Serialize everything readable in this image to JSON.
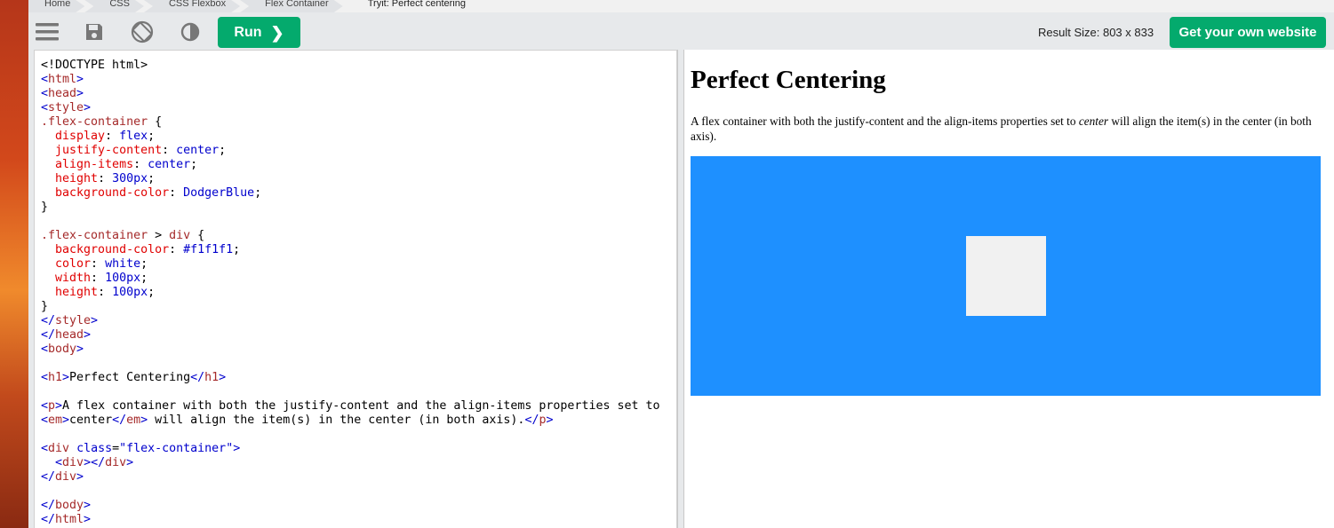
{
  "breadcrumb": [
    "Home",
    "CSS",
    "CSS Flexbox",
    "Flex Container",
    "Tryit: Perfect centering"
  ],
  "toolbar": {
    "menu_icon": "hamburger-menu-icon",
    "save_icon": "save-icon",
    "orientation_icon": "rotate-orientation-icon",
    "theme_icon": "contrast-theme-icon",
    "run_label": "Run",
    "run_chevron": "❯",
    "result_size": "Result Size: 803 x 833",
    "get_website_label": "Get your own website"
  },
  "colors": {
    "accent_green": "#04aa6d",
    "dodger_blue": "#1e90ff",
    "inner_box": "#f1f1f1"
  },
  "editor": {
    "lines": [
      [
        [
          "t-txt",
          "<!DOCTYPE html>"
        ]
      ],
      [
        [
          "t-br",
          "<"
        ],
        [
          "t-tag",
          "html"
        ],
        [
          "t-br",
          ">"
        ]
      ],
      [
        [
          "t-br",
          "<"
        ],
        [
          "t-tag",
          "head"
        ],
        [
          "t-br",
          ">"
        ]
      ],
      [
        [
          "t-br",
          "<"
        ],
        [
          "t-tag",
          "style"
        ],
        [
          "t-br",
          ">"
        ]
      ],
      [
        [
          "t-sel",
          ".flex-container"
        ],
        [
          "t-txt",
          " {"
        ]
      ],
      [
        [
          "t-txt",
          "  "
        ],
        [
          "t-prop",
          "display"
        ],
        [
          "t-txt",
          ": "
        ],
        [
          "t-val",
          "flex"
        ],
        [
          "t-txt",
          ";"
        ]
      ],
      [
        [
          "t-txt",
          "  "
        ],
        [
          "t-prop",
          "justify-content"
        ],
        [
          "t-txt",
          ": "
        ],
        [
          "t-val",
          "center"
        ],
        [
          "t-txt",
          ";"
        ]
      ],
      [
        [
          "t-txt",
          "  "
        ],
        [
          "t-prop",
          "align-items"
        ],
        [
          "t-txt",
          ": "
        ],
        [
          "t-val",
          "center"
        ],
        [
          "t-txt",
          ";"
        ]
      ],
      [
        [
          "t-txt",
          "  "
        ],
        [
          "t-prop",
          "height"
        ],
        [
          "t-txt",
          ": "
        ],
        [
          "t-val",
          "300px"
        ],
        [
          "t-txt",
          ";"
        ]
      ],
      [
        [
          "t-txt",
          "  "
        ],
        [
          "t-prop",
          "background-color"
        ],
        [
          "t-txt",
          ": "
        ],
        [
          "t-val",
          "DodgerBlue"
        ],
        [
          "t-txt",
          ";"
        ]
      ],
      [
        [
          "t-txt",
          "}"
        ]
      ],
      [
        [
          "t-txt",
          ""
        ]
      ],
      [
        [
          "t-sel",
          ".flex-container"
        ],
        [
          "t-txt",
          " > "
        ],
        [
          "t-sel",
          "div"
        ],
        [
          "t-txt",
          " {"
        ]
      ],
      [
        [
          "t-txt",
          "  "
        ],
        [
          "t-prop",
          "background-color"
        ],
        [
          "t-txt",
          ": "
        ],
        [
          "t-val",
          "#f1f1f1"
        ],
        [
          "t-txt",
          ";"
        ]
      ],
      [
        [
          "t-txt",
          "  "
        ],
        [
          "t-prop",
          "color"
        ],
        [
          "t-txt",
          ": "
        ],
        [
          "t-val",
          "white"
        ],
        [
          "t-txt",
          ";"
        ]
      ],
      [
        [
          "t-txt",
          "  "
        ],
        [
          "t-prop",
          "width"
        ],
        [
          "t-txt",
          ": "
        ],
        [
          "t-val",
          "100px"
        ],
        [
          "t-txt",
          ";"
        ]
      ],
      [
        [
          "t-txt",
          "  "
        ],
        [
          "t-prop",
          "height"
        ],
        [
          "t-txt",
          ": "
        ],
        [
          "t-val",
          "100px"
        ],
        [
          "t-txt",
          ";"
        ]
      ],
      [
        [
          "t-txt",
          "}"
        ]
      ],
      [
        [
          "t-br",
          "</"
        ],
        [
          "t-tag",
          "style"
        ],
        [
          "t-br",
          ">"
        ]
      ],
      [
        [
          "t-br",
          "</"
        ],
        [
          "t-tag",
          "head"
        ],
        [
          "t-br",
          ">"
        ]
      ],
      [
        [
          "t-br",
          "<"
        ],
        [
          "t-tag",
          "body"
        ],
        [
          "t-br",
          ">"
        ]
      ],
      [
        [
          "t-txt",
          ""
        ]
      ],
      [
        [
          "t-br",
          "<"
        ],
        [
          "t-tag",
          "h1"
        ],
        [
          "t-br",
          ">"
        ],
        [
          "t-txt",
          "Perfect Centering"
        ],
        [
          "t-br",
          "</"
        ],
        [
          "t-tag",
          "h1"
        ],
        [
          "t-br",
          ">"
        ]
      ],
      [
        [
          "t-txt",
          ""
        ]
      ],
      [
        [
          "t-br",
          "<"
        ],
        [
          "t-tag",
          "p"
        ],
        [
          "t-br",
          ">"
        ],
        [
          "t-txt",
          "A flex container with both the justify-content and the align-items properties set to"
        ]
      ],
      [
        [
          "t-br",
          "<"
        ],
        [
          "t-tag",
          "em"
        ],
        [
          "t-br",
          ">"
        ],
        [
          "t-txt",
          "center"
        ],
        [
          "t-br",
          "</"
        ],
        [
          "t-tag",
          "em"
        ],
        [
          "t-br",
          ">"
        ],
        [
          "t-txt",
          " will align the item(s) in the center (in both axis)."
        ],
        [
          "t-br",
          "</"
        ],
        [
          "t-tag",
          "p"
        ],
        [
          "t-br",
          ">"
        ]
      ],
      [
        [
          "t-txt",
          ""
        ]
      ],
      [
        [
          "t-br",
          "<"
        ],
        [
          "t-tag",
          "div"
        ],
        [
          "t-txt",
          " "
        ],
        [
          "t-attr",
          "class"
        ],
        [
          "t-txt",
          "="
        ],
        [
          "t-str",
          "\"flex-container\""
        ],
        [
          "t-br",
          ">"
        ]
      ],
      [
        [
          "t-txt",
          "  "
        ],
        [
          "t-br",
          "<"
        ],
        [
          "t-tag",
          "div"
        ],
        [
          "t-br",
          "></"
        ],
        [
          "t-tag",
          "div"
        ],
        [
          "t-br",
          ">"
        ]
      ],
      [
        [
          "t-br",
          "</"
        ],
        [
          "t-tag",
          "div"
        ],
        [
          "t-br",
          ">"
        ]
      ],
      [
        [
          "t-txt",
          ""
        ]
      ],
      [
        [
          "t-br",
          "</"
        ],
        [
          "t-tag",
          "body"
        ],
        [
          "t-br",
          ">"
        ]
      ],
      [
        [
          "t-br",
          "</"
        ],
        [
          "t-tag",
          "html"
        ],
        [
          "t-br",
          ">"
        ]
      ]
    ]
  },
  "result": {
    "heading": "Perfect Centering",
    "para_before": "A flex container with both the justify-content and the align-items properties set to ",
    "para_em": "center",
    "para_after": " will align the item(s) in the center (in both axis)."
  }
}
